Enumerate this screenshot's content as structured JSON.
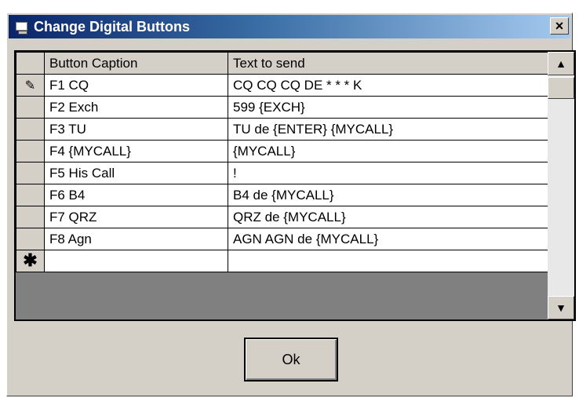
{
  "window": {
    "title": "Change Digital Buttons",
    "close_label": "×"
  },
  "grid": {
    "columns": [
      "Button Caption",
      "Text to send"
    ],
    "rows": [
      {
        "caption": "F1 CQ",
        "text": "CQ CQ CQ DE * * * K"
      },
      {
        "caption": "F2 Exch",
        "text": "599 {EXCH}"
      },
      {
        "caption": "F3 TU",
        "text": "TU de {ENTER} {MYCALL}"
      },
      {
        "caption": "F4 {MYCALL}",
        "text": "{MYCALL}"
      },
      {
        "caption": "F5 His Call",
        "text": "!"
      },
      {
        "caption": "F6 B4",
        "text": "B4 de {MYCALL}"
      },
      {
        "caption": "F7 QRZ",
        "text": "QRZ de {MYCALL}"
      },
      {
        "caption": "F8 Agn",
        "text": "AGN AGN de {MYCALL}"
      }
    ],
    "current_row_marker": "✎",
    "new_row_marker": "✱",
    "scroll_up": "▲",
    "scroll_down": "▼"
  },
  "ok_label": "Ok"
}
